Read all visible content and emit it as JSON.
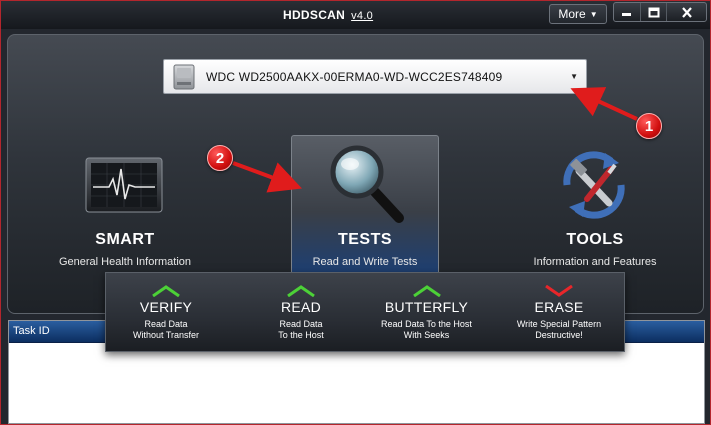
{
  "window": {
    "app_name": "HDDSCAN",
    "version": "v4.0",
    "more_label": "More",
    "minimize_icon": "minimize-icon",
    "maximize_icon": "maximize-icon",
    "close_icon": "close-icon"
  },
  "drive_selector": {
    "value": "WDC WD2500AAKX-00ERMA0-WD-WCC2ES748409",
    "icon": "hard-drive-icon"
  },
  "sections": {
    "smart": {
      "title": "SMART",
      "subtitle": "General Health Information",
      "icon": "heart-monitor-icon"
    },
    "tests": {
      "title": "TESTS",
      "subtitle": "Read and Write Tests",
      "icon": "magnifier-icon"
    },
    "tools": {
      "title": "TOOLS",
      "subtitle": "Information and Features",
      "icon": "tools-icon"
    }
  },
  "tests_menu": [
    {
      "label": "VERIFY",
      "desc_line1": "Read Data",
      "desc_line2": "Without Transfer",
      "arrow": "up-arrow-icon",
      "arrow_color": "#4cd137"
    },
    {
      "label": "READ",
      "desc_line1": "Read Data",
      "desc_line2": "To the Host",
      "arrow": "up-arrow-icon",
      "arrow_color": "#4cd137"
    },
    {
      "label": "BUTTERFLY",
      "desc_line1": "Read Data To the Host",
      "desc_line2": "With Seeks",
      "arrow": "up-arrow-icon",
      "arrow_color": "#4cd137"
    },
    {
      "label": "ERASE",
      "desc_line1": "Write Special Pattern",
      "desc_line2": "Destructive!",
      "arrow": "down-arrow-icon",
      "arrow_color": "#e8262a"
    }
  ],
  "task_list": {
    "columns": [
      "Task ID"
    ]
  },
  "annotations": [
    {
      "number": "1"
    },
    {
      "number": "2"
    }
  ],
  "colors": {
    "accent_border": "#b3262d",
    "annotation_red": "#e01c1c",
    "tests_highlight": "#1d3f73"
  }
}
